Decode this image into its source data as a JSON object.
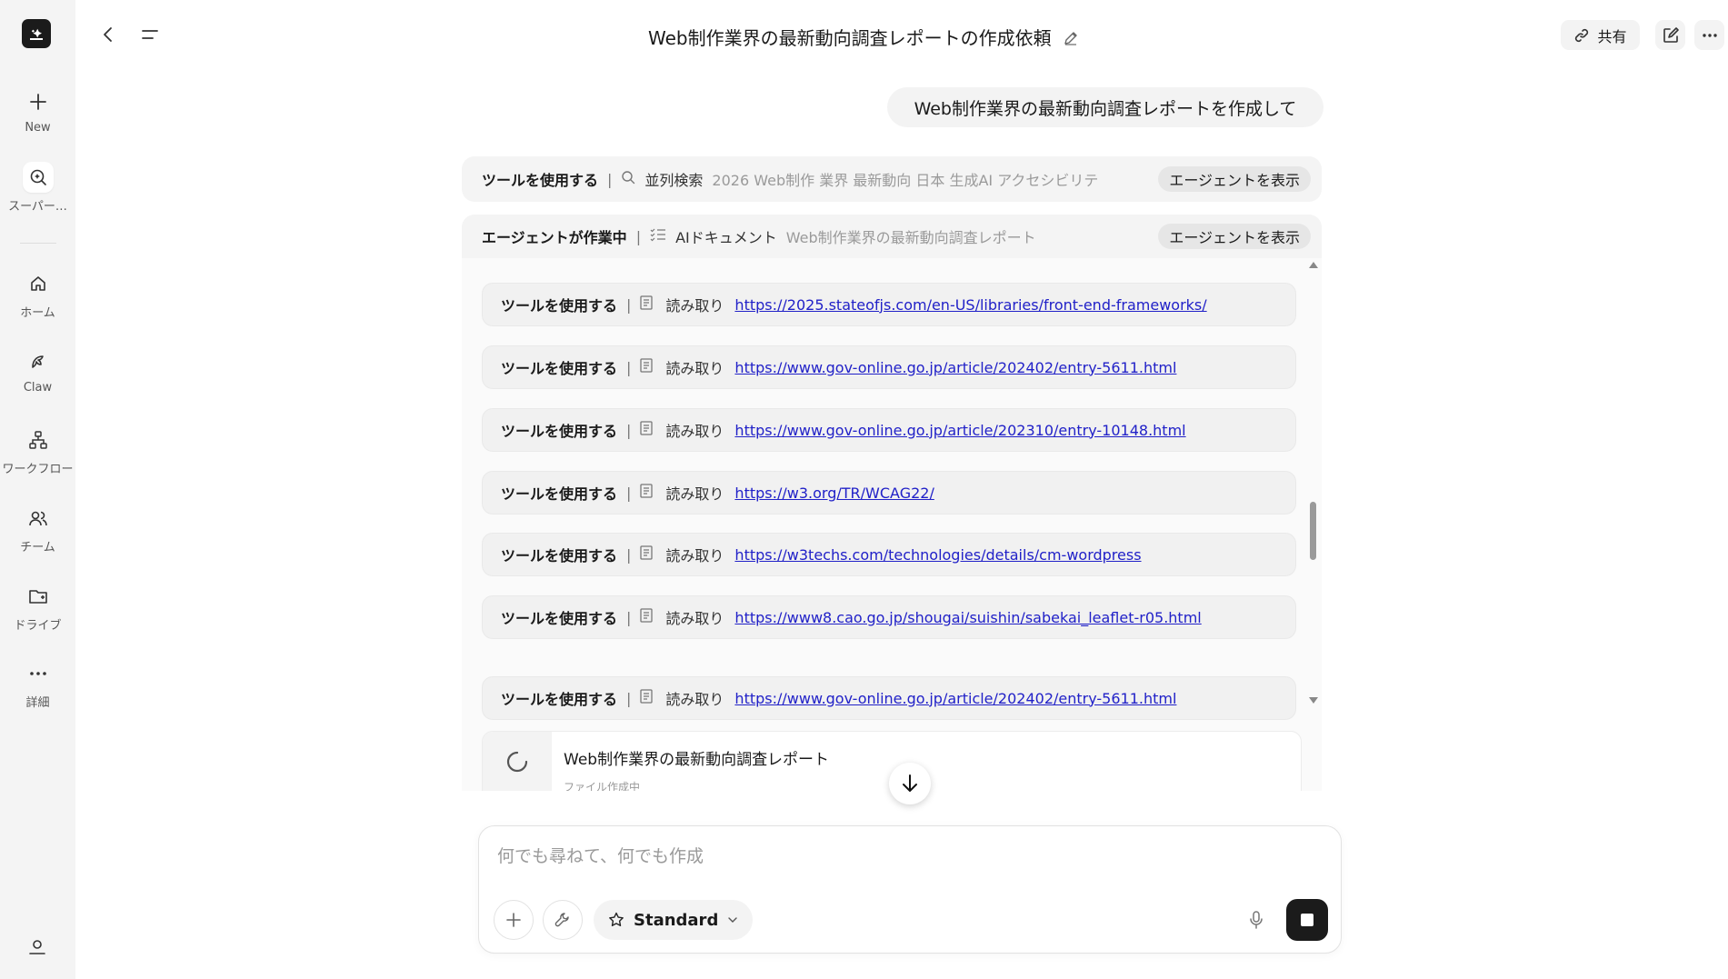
{
  "sidebar": {
    "items": [
      {
        "label": "New",
        "icon": "plus-icon"
      },
      {
        "label": "スーパー…",
        "icon": "super-agent-icon"
      },
      {
        "label": "ホーム",
        "icon": "home-icon"
      },
      {
        "label": "Claw",
        "icon": "claw-icon"
      },
      {
        "label": "ワークフロー",
        "icon": "workflow-icon"
      },
      {
        "label": "チーム",
        "icon": "team-icon"
      },
      {
        "label": "ドライブ",
        "icon": "drive-icon"
      },
      {
        "label": "詳細",
        "icon": "more-icon"
      }
    ]
  },
  "header": {
    "title": "Web制作業界の最新動向調査レポートの作成依頼",
    "share_label": "共有"
  },
  "chat": {
    "user_message": "Web制作業界の最新動向調査レポートを作成して",
    "search_tool": {
      "label": "ツールを使用する",
      "action": "並列検索",
      "query": "2026 Web制作 業界 最新動向 日本 生成AI アクセシビリテ",
      "button": "エージェントを表示"
    },
    "agent": {
      "status": "エージェントが作業中",
      "doc_type": "AIドキュメント",
      "doc_name": "Web制作業界の最新動向調査レポート",
      "button": "エージェントを表示",
      "tool_calls": [
        {
          "label": "ツールを使用する",
          "action": "読み取り",
          "url": "https://2025.stateofjs.com/en-US/libraries/front-end-frameworks/"
        },
        {
          "label": "ツールを使用する",
          "action": "読み取り",
          "url": "https://www.gov-online.go.jp/article/202402/entry-5611.html"
        },
        {
          "label": "ツールを使用する",
          "action": "読み取り",
          "url": "https://www.gov-online.go.jp/article/202310/entry-10148.html"
        },
        {
          "label": "ツールを使用する",
          "action": "読み取り",
          "url": "https://w3.org/TR/WCAG22/"
        },
        {
          "label": "ツールを使用する",
          "action": "読み取り",
          "url": "https://w3techs.com/technologies/details/cm-wordpress"
        },
        {
          "label": "ツールを使用する",
          "action": "読み取り",
          "url": "https://www8.cao.go.jp/shougai/suishin/sabekai_leaflet-r05.html"
        },
        {
          "label": "ツールを使用する",
          "action": "読み取り",
          "url": "https://www.gov-online.go.jp/article/202402/entry-5611.html"
        }
      ]
    },
    "file_card": {
      "title": "Web制作業界の最新動向調査レポート",
      "status": "ファイル作成中"
    }
  },
  "composer": {
    "placeholder": "何でも尋ねて、何でも作成",
    "value": "",
    "mode_label": "Standard"
  }
}
